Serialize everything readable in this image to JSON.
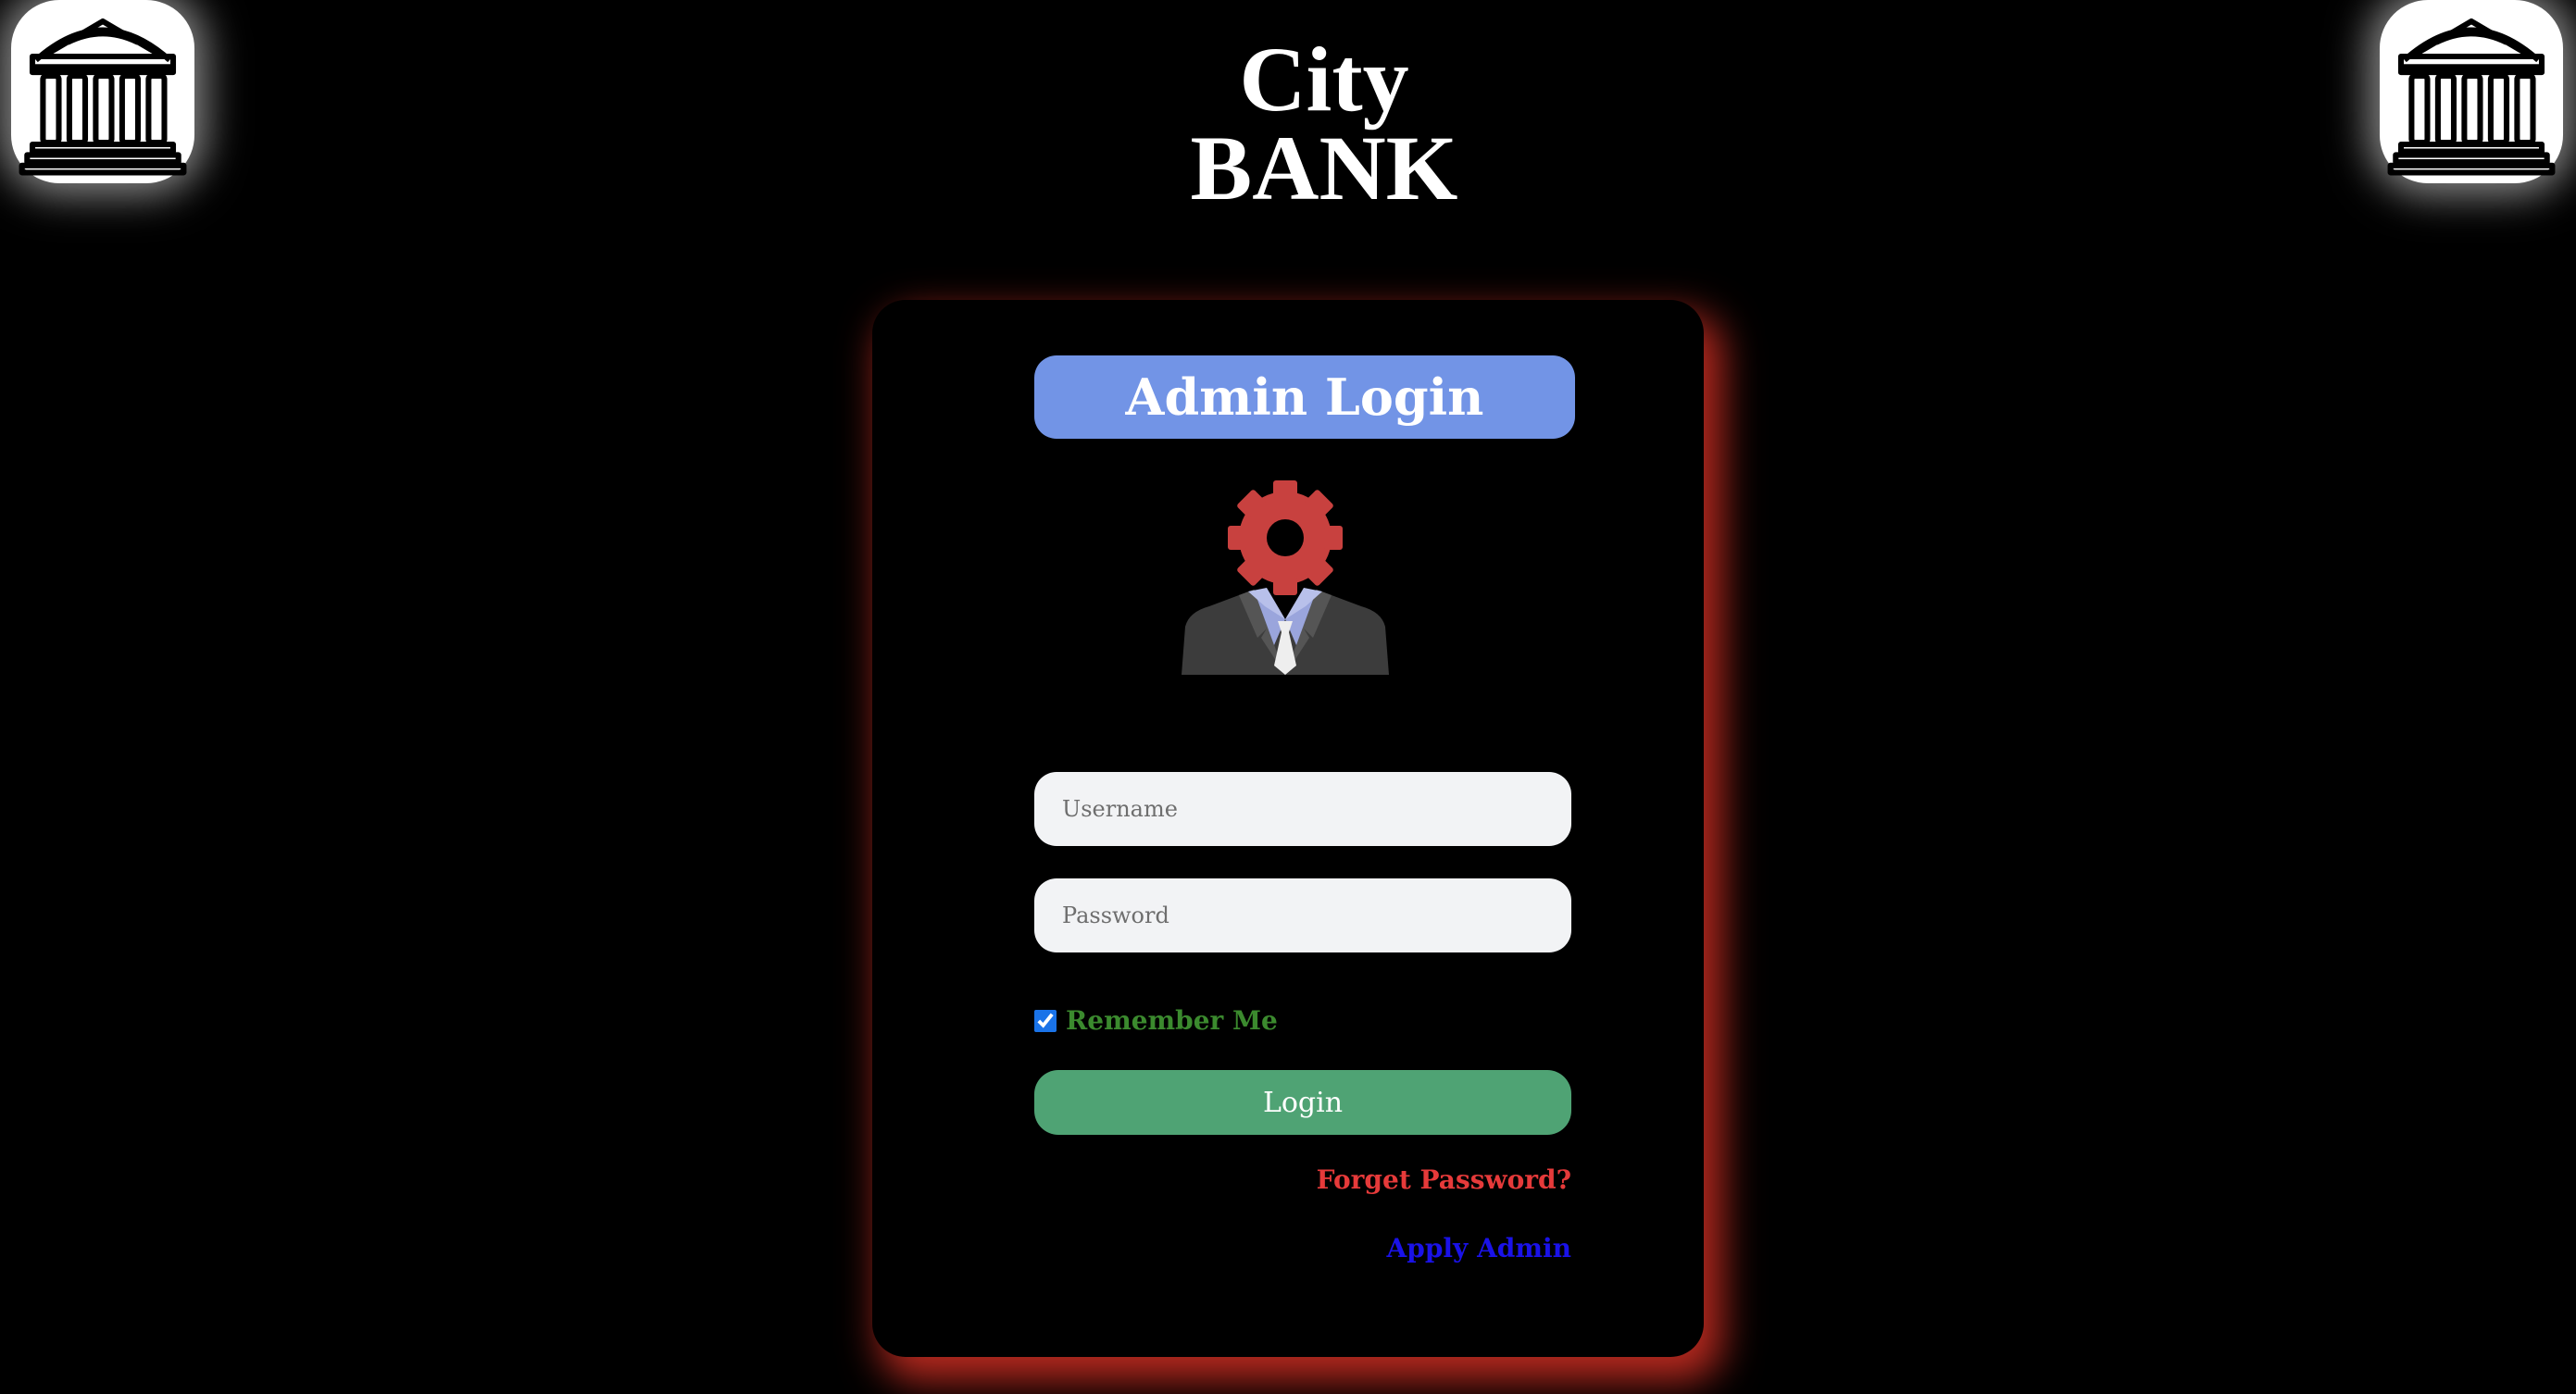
{
  "brand": {
    "line1": "City",
    "line2": "BANK"
  },
  "logos": {
    "left_icon": "bank-building-icon",
    "right_icon": "bank-building-icon"
  },
  "login_card": {
    "title": "Admin Login",
    "avatar_icon": "admin-gear-avatar-icon",
    "username_placeholder": "Username",
    "username_value": "",
    "password_placeholder": "Password",
    "password_value": "",
    "remember_label": "Remember Me",
    "remember_checked": true,
    "login_label": "Login",
    "forget_link": "Forget Password?",
    "apply_link": "Apply Admin"
  },
  "colors": {
    "background": "#000000",
    "title_pill": "#7294e6",
    "login_button": "#4fa374",
    "remember_text": "#3b8a2e",
    "forget_link": "#e63a3a",
    "apply_link": "#1a12e8",
    "card_glow": "#d63024",
    "gear": "#c8413f"
  }
}
